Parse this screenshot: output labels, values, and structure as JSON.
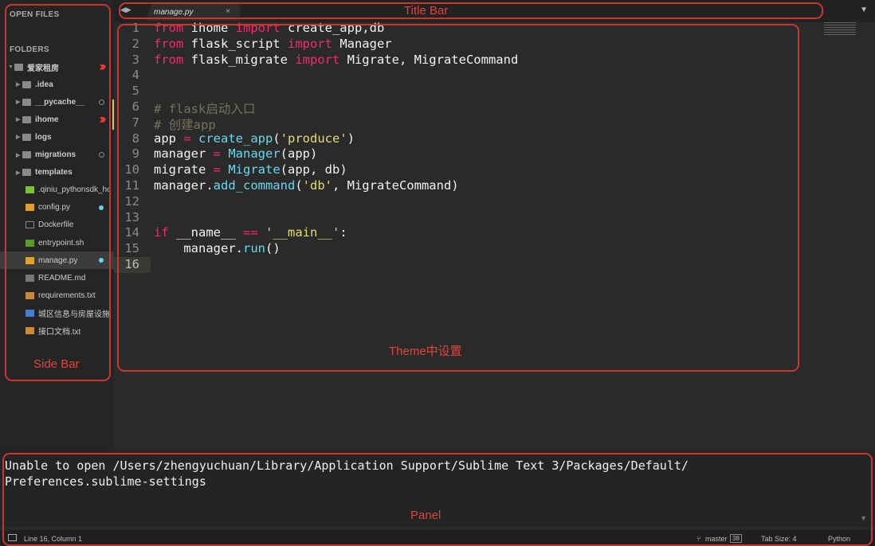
{
  "sidebar": {
    "open_files": "OPEN FILES",
    "folders": "FOLDERS",
    "items": [
      {
        "label": "爱家租房",
        "type": "folder-open",
        "mark": "flag"
      },
      {
        "label": ".idea",
        "type": "folder"
      },
      {
        "label": "__pycache__",
        "type": "folder",
        "mark": "ring"
      },
      {
        "label": "ihome",
        "type": "folder",
        "mark": "flag"
      },
      {
        "label": "logs",
        "type": "folder"
      },
      {
        "label": "migrations",
        "type": "folder",
        "mark": "ring"
      },
      {
        "label": "templates",
        "type": "folder"
      },
      {
        "label": ".qiniu_pythonsdk_hostscache.json",
        "type": "db"
      },
      {
        "label": "config.py",
        "type": "python",
        "mark": "dot"
      },
      {
        "label": "Dockerfile",
        "type": "file"
      },
      {
        "label": "entrypoint.sh",
        "type": "shell"
      },
      {
        "label": "manage.py",
        "type": "python",
        "mark": "dot",
        "selected": true
      },
      {
        "label": "README.md",
        "type": "md"
      },
      {
        "label": "requirements.txt",
        "type": "text"
      },
      {
        "label": "城区信息与房屋设施信息.sql",
        "type": "db2"
      },
      {
        "label": "接口文档.txt",
        "type": "text"
      }
    ]
  },
  "tab": {
    "label": "manage.py",
    "close": "×"
  },
  "code": [
    [
      [
        "k",
        "from"
      ],
      [
        "t",
        " ihome "
      ],
      [
        "k",
        "import"
      ],
      [
        "t",
        " create_app,db"
      ]
    ],
    [
      [
        "k",
        "from"
      ],
      [
        "t",
        " flask_script "
      ],
      [
        "k",
        "import"
      ],
      [
        "t",
        " Manager"
      ]
    ],
    [
      [
        "k",
        "from"
      ],
      [
        "t",
        " flask_migrate "
      ],
      [
        "k",
        "import"
      ],
      [
        "t",
        " Migrate, MigrateCommand"
      ]
    ],
    [],
    [],
    [
      [
        "c",
        "# flask启动入口"
      ]
    ],
    [
      [
        "c",
        "# 创建app"
      ]
    ],
    [
      [
        "t",
        "app "
      ],
      [
        "k",
        "="
      ],
      [
        "t",
        " "
      ],
      [
        "f",
        "create_app"
      ],
      [
        "t",
        "("
      ],
      [
        "s",
        "'produce'"
      ],
      [
        "t",
        ")"
      ]
    ],
    [
      [
        "t",
        "manager "
      ],
      [
        "k",
        "="
      ],
      [
        "t",
        " "
      ],
      [
        "f",
        "Manager"
      ],
      [
        "t",
        "(app)"
      ]
    ],
    [
      [
        "t",
        "migrate "
      ],
      [
        "k",
        "="
      ],
      [
        "t",
        " "
      ],
      [
        "f",
        "Migrate"
      ],
      [
        "t",
        "(app, db)"
      ]
    ],
    [
      [
        "t",
        "manager."
      ],
      [
        "f",
        "add_command"
      ],
      [
        "t",
        "("
      ],
      [
        "s",
        "'db'"
      ],
      [
        "t",
        ", MigrateCommand)"
      ]
    ],
    [],
    [],
    [
      [
        "k",
        "if"
      ],
      [
        "t",
        " __name__ "
      ],
      [
        "k",
        "=="
      ],
      [
        "t",
        " "
      ],
      [
        "s",
        "'__main__'"
      ],
      [
        "t",
        ":"
      ]
    ],
    [
      [
        "t",
        "    manager."
      ],
      [
        "f",
        "run"
      ],
      [
        "t",
        "()"
      ]
    ],
    []
  ],
  "panel": {
    "line1": "Unable to open /Users/zhengyuchuan/Library/Application Support/Sublime Text 3/Packages/Default/",
    "line2": "Preferences.sublime-settings"
  },
  "status": {
    "position": "Line 16, Column 1",
    "branch": "master",
    "branch_count": "38",
    "tab_size": "Tab Size: 4",
    "syntax": "Python"
  },
  "annotations": {
    "title_bar": "Title Bar",
    "theme": "Theme中设置",
    "side_bar": "Side Bar",
    "panel": "Panel"
  }
}
